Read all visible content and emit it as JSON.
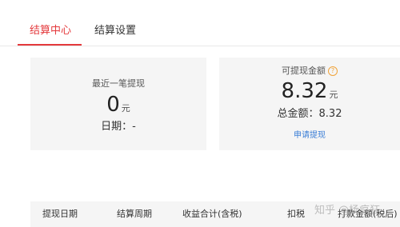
{
  "tabs": [
    {
      "label": "结算中心",
      "active": true
    },
    {
      "label": "结算设置",
      "active": false
    }
  ],
  "last_withdrawal": {
    "label": "最近一笔提现",
    "amount": "0",
    "unit": "元",
    "date_label": "日期：",
    "date_value": "-"
  },
  "withdrawable": {
    "label": "可提现金额",
    "help_icon": "question-circle-icon",
    "amount": "8.32",
    "unit": "元",
    "total_label": "总金额：",
    "total_value": "8.32",
    "apply_link": "申请提现"
  },
  "table": {
    "columns": [
      "提现日期",
      "结算周期",
      "收益合计(含税)",
      "扣税",
      "打款金额(税后)"
    ]
  },
  "watermark": "知乎 @杨疯狂",
  "colors": {
    "accent": "#e4393c",
    "link": "#3b7ed6",
    "help": "#f0a33a",
    "card_bg": "#f5f5f5"
  }
}
